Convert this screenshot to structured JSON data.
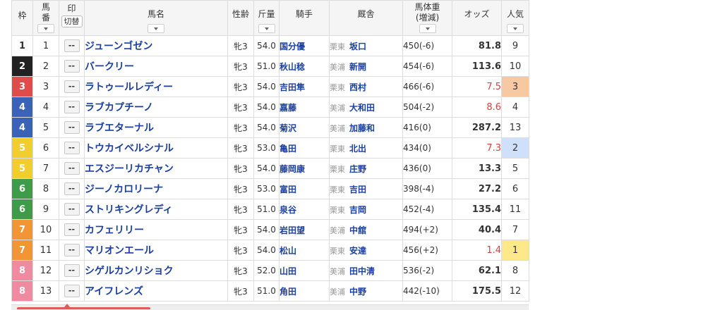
{
  "header": {
    "waku": "枠",
    "umaban": "馬\n番",
    "mark": "印",
    "mark_switch": "切替",
    "name": "馬名",
    "sexage": "性齢",
    "kinryo": "斤量",
    "jockey": "騎手",
    "trainer": "厩舎",
    "weight": "馬体重\n(増減)",
    "odds": "オッズ",
    "pop": "人気"
  },
  "colors": {
    "waku_1": "#ffffff",
    "waku_2": "#222222",
    "waku_3": "#e04c4c",
    "waku_4": "#3a63b8",
    "waku_5": "#f2cd2e",
    "waku_6": "#3e9b49",
    "waku_7": "#f39534",
    "waku_8": "#f08aa0",
    "pop_1": "#fde98a",
    "pop_2": "#cfe0fb",
    "pop_3": "#f6c9a3",
    "link": "#1a3fa0",
    "hot_odds": "#e03c3c"
  },
  "rows": [
    {
      "waku": "1",
      "umaban": "1",
      "mark": "--",
      "name": "ジューンゴゼン",
      "sexage": "牝3",
      "kinryo": "54.0",
      "jockey": "国分優",
      "region": "栗東",
      "trainer": "坂口",
      "weight": "450(-6)",
      "odds": "81.8",
      "pop": "9"
    },
    {
      "waku": "2",
      "umaban": "2",
      "mark": "--",
      "name": "バークリー",
      "sexage": "牝3",
      "kinryo": "51.0",
      "jockey": "秋山稔",
      "region": "美浦",
      "trainer": "新開",
      "weight": "454(-6)",
      "odds": "113.6",
      "pop": "10"
    },
    {
      "waku": "3",
      "umaban": "3",
      "mark": "--",
      "name": "ラトゥールレディー",
      "sexage": "牝3",
      "kinryo": "54.0",
      "jockey": "吉田隼",
      "region": "栗東",
      "trainer": "西村",
      "weight": "466(-6)",
      "odds": "7.5",
      "pop": "3"
    },
    {
      "waku": "4",
      "umaban": "4",
      "mark": "--",
      "name": "ラブカプチーノ",
      "sexage": "牝3",
      "kinryo": "54.0",
      "jockey": "嘉藤",
      "region": "美浦",
      "trainer": "大和田",
      "weight": "504(-2)",
      "odds": "8.6",
      "pop": "4"
    },
    {
      "waku": "4",
      "umaban": "5",
      "mark": "--",
      "name": "ラブエターナル",
      "sexage": "牝3",
      "kinryo": "54.0",
      "jockey": "菊沢",
      "region": "美浦",
      "trainer": "加藤和",
      "weight": "416(0)",
      "odds": "287.2",
      "pop": "13"
    },
    {
      "waku": "5",
      "umaban": "6",
      "mark": "--",
      "name": "トウカイベルシナル",
      "sexage": "牝3",
      "kinryo": "53.0",
      "jockey": "亀田",
      "region": "栗東",
      "trainer": "北出",
      "weight": "434(0)",
      "odds": "7.3",
      "pop": "2"
    },
    {
      "waku": "5",
      "umaban": "7",
      "mark": "--",
      "name": "エスジーリカチャン",
      "sexage": "牝3",
      "kinryo": "54.0",
      "jockey": "藤岡康",
      "region": "栗東",
      "trainer": "庄野",
      "weight": "436(0)",
      "odds": "13.3",
      "pop": "5"
    },
    {
      "waku": "6",
      "umaban": "8",
      "mark": "--",
      "name": "ジーノカロリーナ",
      "sexage": "牝3",
      "kinryo": "53.0",
      "jockey": "富田",
      "region": "栗東",
      "trainer": "吉田",
      "weight": "398(-4)",
      "odds": "27.2",
      "pop": "6"
    },
    {
      "waku": "6",
      "umaban": "9",
      "mark": "--",
      "name": "ストリキングレディ",
      "sexage": "牝3",
      "kinryo": "51.0",
      "jockey": "泉谷",
      "region": "栗東",
      "trainer": "吉岡",
      "weight": "452(-4)",
      "odds": "135.4",
      "pop": "11"
    },
    {
      "waku": "7",
      "umaban": "10",
      "mark": "--",
      "name": "カフェリリー",
      "sexage": "牝3",
      "kinryo": "54.0",
      "jockey": "岩田望",
      "region": "美浦",
      "trainer": "中舘",
      "weight": "494(+2)",
      "odds": "40.4",
      "pop": "7"
    },
    {
      "waku": "7",
      "umaban": "11",
      "mark": "--",
      "name": "マリオンエール",
      "sexage": "牝3",
      "kinryo": "54.0",
      "jockey": "松山",
      "region": "栗東",
      "trainer": "安達",
      "weight": "456(+2)",
      "odds": "1.4",
      "pop": "1"
    },
    {
      "waku": "8",
      "umaban": "12",
      "mark": "--",
      "name": "シゲルカンリショク",
      "sexage": "牝3",
      "kinryo": "52.0",
      "jockey": "山田",
      "region": "美浦",
      "trainer": "田中清",
      "weight": "536(-2)",
      "odds": "62.1",
      "pop": "8"
    },
    {
      "waku": "8",
      "umaban": "13",
      "mark": "--",
      "name": "アイフレンズ",
      "sexage": "牝3",
      "kinryo": "51.0",
      "jockey": "角田",
      "region": "美浦",
      "trainer": "中野",
      "weight": "442(-10)",
      "odds": "175.5",
      "pop": "12"
    }
  ]
}
